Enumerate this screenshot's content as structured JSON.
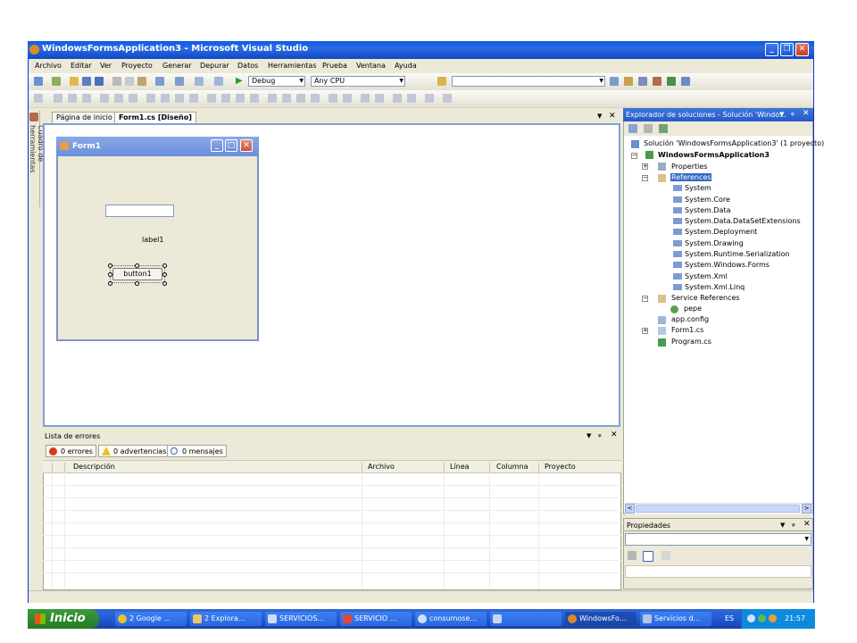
{
  "window": {
    "title": "WindowsFormsApplication3 - Microsoft Visual Studio"
  },
  "menu": [
    "Archivo",
    "Editar",
    "Ver",
    "Proyecto",
    "Generar",
    "Depurar",
    "Datos",
    "Herramientas",
    "Prueba",
    "Ventana",
    "Ayuda"
  ],
  "toolbar": {
    "config": "Debug",
    "platform": "Any CPU",
    "start_arrow": "▶"
  },
  "toolbox_tab": "Cuadro de herramientas",
  "doc_tabs": [
    {
      "label": "Página de inicio"
    },
    {
      "label": "Form1.cs [Diseño]"
    }
  ],
  "form": {
    "title": "Form1",
    "label": "label1",
    "button": "button1"
  },
  "error_list": {
    "title": "Lista de errores",
    "filters": {
      "errors": "0 errores",
      "warnings": "0 advertencias",
      "messages": "0 mensajes"
    },
    "columns": [
      "Descripción",
      "Archivo",
      "Línea",
      "Columna",
      "Proyecto"
    ]
  },
  "solution_explorer": {
    "title": "Explorador de soluciones - Solución 'Windo...",
    "items": [
      {
        "label": "Solución 'WindowsFormsApplication3' (1 proyecto)"
      },
      {
        "label": "WindowsFormsApplication3"
      },
      {
        "label": "Properties"
      },
      {
        "label": "References"
      },
      {
        "label": "System"
      },
      {
        "label": "System.Core"
      },
      {
        "label": "System.Data"
      },
      {
        "label": "System.Data.DataSetExtensions"
      },
      {
        "label": "System.Deployment"
      },
      {
        "label": "System.Drawing"
      },
      {
        "label": "System.Runtime.Serialization"
      },
      {
        "label": "System.Windows.Forms"
      },
      {
        "label": "System.Xml"
      },
      {
        "label": "System.Xml.Linq"
      },
      {
        "label": "Service References"
      },
      {
        "label": "pepe"
      },
      {
        "label": "app.config"
      },
      {
        "label": "Form1.cs"
      },
      {
        "label": "Program.cs"
      }
    ]
  },
  "properties": {
    "title": "Propiedades"
  },
  "taskbar": {
    "start": "Inicio",
    "tasks": [
      "2 Google ...",
      "2 Explora...",
      "SERVICIOS...",
      "SERVICIO ...",
      "consumose...",
      "",
      "WindowsFo...",
      "Servicios d..."
    ],
    "lang": "ES",
    "clock": "21:57"
  },
  "colors": {
    "accent": "#0a5ce6",
    "selection": "#316ac5",
    "taskbar": "#245edb",
    "start": "#2f8a2f"
  }
}
